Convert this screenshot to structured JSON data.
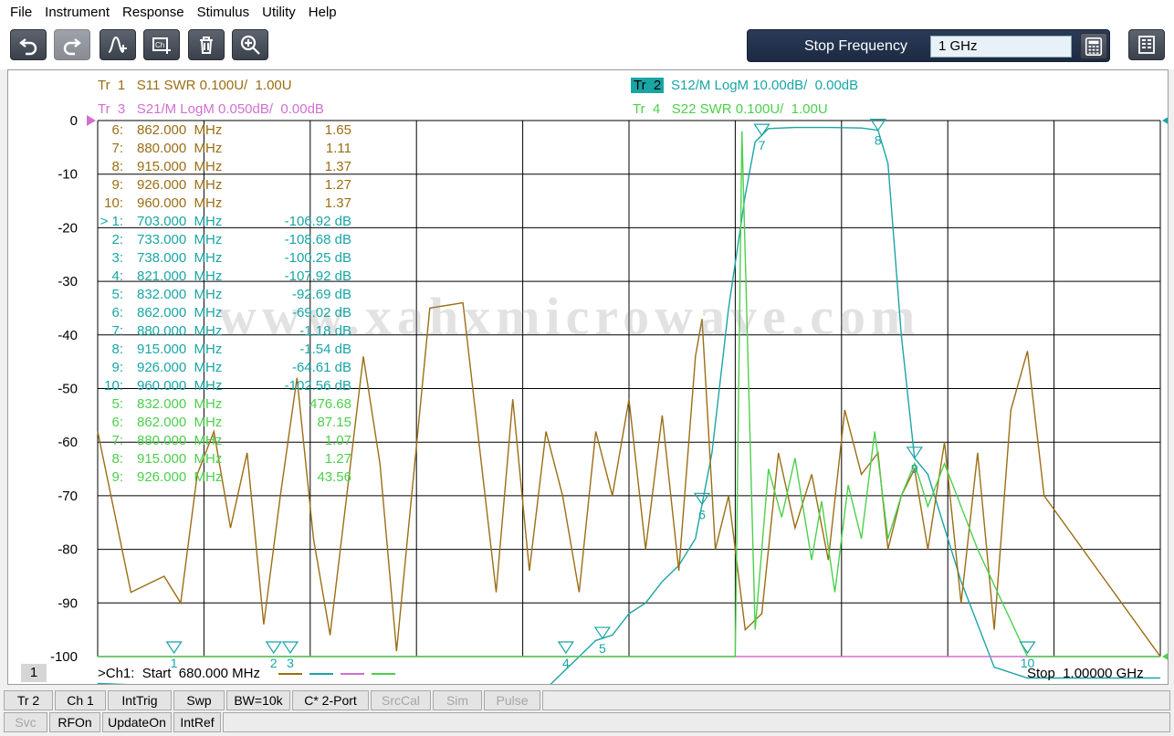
{
  "menu": [
    "File",
    "Instrument",
    "Response",
    "Stimulus",
    "Utility",
    "Help"
  ],
  "toolbar": {
    "buttons": [
      {
        "name": "undo-icon"
      },
      {
        "name": "redo-icon"
      },
      {
        "name": "add-marker-icon"
      },
      {
        "name": "add-channel-icon"
      },
      {
        "name": "delete-trace-icon"
      },
      {
        "name": "zoom-icon"
      }
    ],
    "entry_label": "Stop Frequency",
    "entry_value": "1 GHz"
  },
  "colors": {
    "tr1": "#9b6e14",
    "tr2": "#1aa5a5",
    "tr3": "#d070d0",
    "tr4": "#4cd04c",
    "grid": "#000000",
    "accent": "#1aa5a5"
  },
  "traces": {
    "tr1": "Tr  1   S11 SWR 0.100U/  1.00U",
    "tr2_tag": "Tr  2",
    "tr2": "S12/M LogM 10.00dB/  0.00dB",
    "tr3": "Tr  3   S21/M LogM 0.050dB/  0.00dB",
    "tr4": "Tr  4   S22 SWR 0.100U/  1.00U"
  },
  "y_axis": [
    "0",
    "-10",
    "-20",
    "-30",
    "-40",
    "-50",
    "-60",
    "-70",
    "-80",
    "-90",
    "-100"
  ],
  "marker_table": [
    {
      "num": "6:",
      "freq": "862.000  MHz",
      "val": "1.65",
      "trace": "tr1"
    },
    {
      "num": "7:",
      "freq": "880.000  MHz",
      "val": "1.11",
      "trace": "tr1"
    },
    {
      "num": "8:",
      "freq": "915.000  MHz",
      "val": "1.37",
      "trace": "tr1"
    },
    {
      "num": "9:",
      "freq": "926.000  MHz",
      "val": "1.27",
      "trace": "tr1"
    },
    {
      "num": "10:",
      "freq": "960.000  MHz",
      "val": "1.37",
      "trace": "tr1"
    },
    {
      "num": "> 1:",
      "freq": "703.000  MHz",
      "val": "-106.92 dB",
      "trace": "tr2"
    },
    {
      "num": "2:",
      "freq": "733.000  MHz",
      "val": "-108.68 dB",
      "trace": "tr2"
    },
    {
      "num": "3:",
      "freq": "738.000  MHz",
      "val": "-100.25 dB",
      "trace": "tr2"
    },
    {
      "num": "4:",
      "freq": "821.000  MHz",
      "val": "-107.92 dB",
      "trace": "tr2"
    },
    {
      "num": "5:",
      "freq": "832.000  MHz",
      "val": "-92.69 dB",
      "trace": "tr2"
    },
    {
      "num": "6:",
      "freq": "862.000  MHz",
      "val": "-69.02 dB",
      "trace": "tr2"
    },
    {
      "num": "7:",
      "freq": "880.000  MHz",
      "val": "-1.18 dB",
      "trace": "tr2"
    },
    {
      "num": "8:",
      "freq": "915.000  MHz",
      "val": "-1.54 dB",
      "trace": "tr2"
    },
    {
      "num": "9:",
      "freq": "926.000  MHz",
      "val": "-64.61 dB",
      "trace": "tr2"
    },
    {
      "num": "10:",
      "freq": "960.000  MHz",
      "val": "-102.56 dB",
      "trace": "tr2"
    },
    {
      "num": "5:",
      "freq": "832.000  MHz",
      "val": "476.68",
      "trace": "tr4"
    },
    {
      "num": "6:",
      "freq": "862.000  MHz",
      "val": "87.15",
      "trace": "tr4"
    },
    {
      "num": "7:",
      "freq": "880.000  MHz",
      "val": "1.07",
      "trace": "tr4"
    },
    {
      "num": "8:",
      "freq": "915.000  MHz",
      "val": "1.27",
      "trace": "tr4"
    },
    {
      "num": "9:",
      "freq": "926.000  MHz",
      "val": "43.56",
      "trace": "tr4"
    }
  ],
  "watermark": "www.xahxmicrowave.com",
  "footer": {
    "channel_box": "1",
    "start": ">Ch1:  Start  680.000 MHz",
    "stop": "Stop  1.00000 GHz"
  },
  "chart_data": {
    "type": "line",
    "title": "",
    "xlabel": "",
    "ylabel": "",
    "xlim": [
      680,
      1000
    ],
    "ylim": [
      -100,
      0
    ],
    "x_unit": "MHz",
    "grid": true,
    "series": [
      {
        "name": "S12/M LogM",
        "key": "tr2",
        "x": [
          680,
          720,
          790,
          815,
          830,
          835,
          840,
          845,
          850,
          855,
          860,
          865,
          870,
          875,
          878,
          882,
          890,
          900,
          910,
          915,
          918,
          922,
          926,
          930,
          940,
          950,
          960,
          1000
        ],
        "y": [
          -105,
          -106,
          -107,
          -106,
          -97,
          -96,
          -92,
          -90,
          -86,
          -83,
          -78,
          -62,
          -35,
          -14,
          -4,
          -1.5,
          -1.3,
          -1.3,
          -1.4,
          -1.8,
          -8,
          -40,
          -63,
          -66,
          -86,
          -102,
          -104,
          -104
        ]
      },
      {
        "name": "S11 SWR",
        "key": "tr1",
        "x": [
          680,
          690,
          700,
          705,
          710,
          715,
          720,
          725,
          730,
          735,
          740,
          745,
          750,
          755,
          760,
          765,
          770,
          780,
          790,
          800,
          805,
          810,
          815,
          820,
          825,
          830,
          835,
          840,
          845,
          850,
          855,
          860,
          862,
          866,
          870,
          875,
          880,
          885,
          890,
          895,
          900,
          905,
          910,
          915,
          918,
          922,
          926,
          930,
          935,
          940,
          945,
          950,
          955,
          960,
          965,
          1000
        ],
        "y": [
          -58,
          -88,
          -85,
          -90,
          -66,
          -58,
          -76,
          -62,
          -94,
          -70,
          -48,
          -78,
          -96,
          -70,
          -44,
          -64,
          -99,
          -35,
          -34,
          -88,
          -52,
          -84,
          -58,
          -70,
          -88,
          -58,
          -70,
          -52,
          -80,
          -55,
          -84,
          -44,
          -37,
          -80,
          -70,
          -95,
          -92,
          -62,
          -76,
          -66,
          -82,
          -54,
          -66,
          -62,
          -80,
          -70,
          -65,
          -80,
          -60,
          -90,
          -62,
          -95,
          -54,
          -43,
          -70,
          -100
        ]
      },
      {
        "name": "S21/M LogM",
        "key": "tr3",
        "x": [
          680,
          1000
        ],
        "y": [
          -100,
          -100
        ]
      },
      {
        "name": "S22 SWR",
        "key": "tr4",
        "x": [
          680,
          860,
          872,
          874,
          878,
          882,
          886,
          890,
          895,
          898,
          902,
          906,
          910,
          914,
          918,
          922,
          926,
          930,
          935,
          945,
          960,
          1000
        ],
        "y": [
          -100,
          -100,
          -100,
          -2,
          -95,
          -65,
          -74,
          -63,
          -82,
          -71,
          -88,
          -68,
          -78,
          -58,
          -78,
          -70,
          -64,
          -72,
          -64,
          -80,
          -100,
          -100
        ]
      }
    ],
    "markers": [
      {
        "num": "1",
        "x": 703
      },
      {
        "num": "2",
        "x": 733
      },
      {
        "num": "3",
        "x": 738
      },
      {
        "num": "4",
        "x": 821
      },
      {
        "num": "5",
        "x": 832
      },
      {
        "num": "6",
        "x": 862
      },
      {
        "num": "7",
        "x": 880
      },
      {
        "num": "8",
        "x": 915
      },
      {
        "num": "9",
        "x": 926
      },
      {
        "num": "10",
        "x": 960
      }
    ]
  },
  "status_row1": [
    {
      "label": "Tr 2",
      "enabled": true
    },
    {
      "label": "Ch 1",
      "enabled": true
    },
    {
      "label": "IntTrig",
      "enabled": true
    },
    {
      "label": "Swp",
      "enabled": true
    },
    {
      "label": "BW=10k",
      "enabled": true
    },
    {
      "label": "C* 2-Port",
      "enabled": true
    },
    {
      "label": "SrcCal",
      "enabled": false
    },
    {
      "label": "Sim",
      "enabled": false
    },
    {
      "label": "Pulse",
      "enabled": false
    }
  ],
  "status_row2": [
    {
      "label": "Svc",
      "enabled": false
    },
    {
      "label": "RFOn",
      "enabled": true
    },
    {
      "label": "UpdateOn",
      "enabled": true
    },
    {
      "label": "IntRef",
      "enabled": true
    }
  ]
}
